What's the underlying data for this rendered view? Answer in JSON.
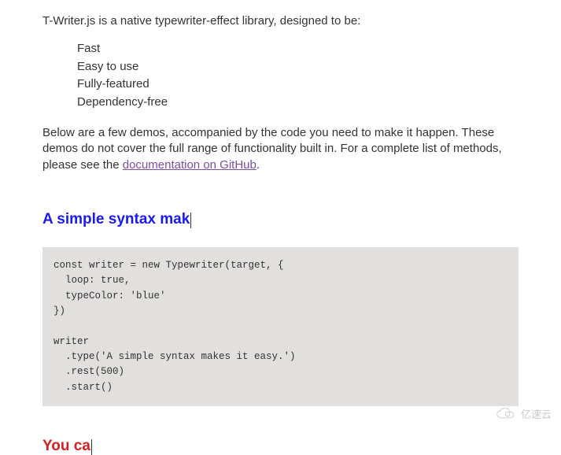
{
  "intro": "T-Writer.js is a native typewriter-effect library, designed to be:",
  "features": [
    "Fast",
    "Easy to use",
    "Fully-featured",
    "Dependency-free"
  ],
  "desc_before_link": "Below are a few demos, accompanied by the code you need to make it happen. These demos do not cover the full range of functionality built in. For a complete list of methods, please see the ",
  "doc_link_text": "documentation on GitHub",
  "desc_after_link": ".",
  "heading_blue": "A simple syntax mak",
  "code_block": "const writer = new Typewriter(target, {\n  loop: true,\n  typeColor: 'blue'\n})\n\nwriter\n  .type('A simple syntax makes it easy.')\n  .rest(500)\n  .start()",
  "heading_red": "You ca",
  "watermark_text": "亿速云"
}
